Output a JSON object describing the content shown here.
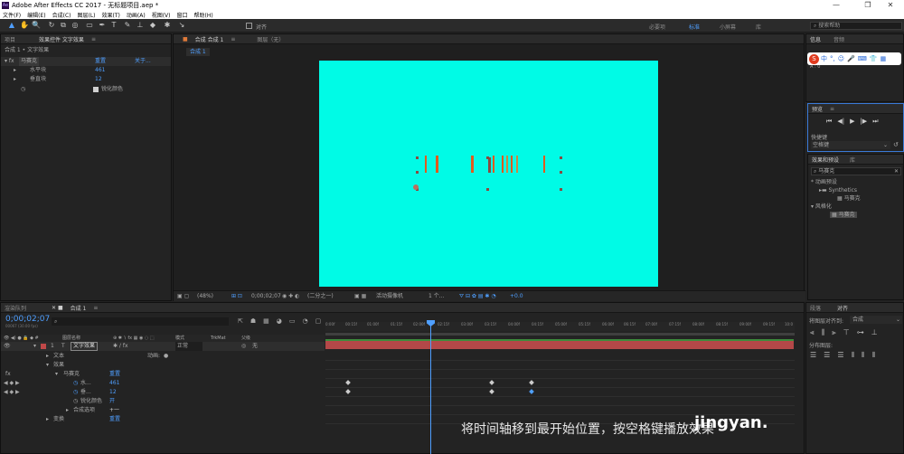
{
  "window": {
    "title": "Adobe After Effects CC 2017 - 无标题项目.aep *",
    "logo": "Ae",
    "controls": [
      "—",
      "❐",
      "✕"
    ]
  },
  "menu": [
    "文件(F)",
    "编辑(E)",
    "合成(C)",
    "图层(L)",
    "效果(T)",
    "动画(A)",
    "视图(V)",
    "窗口",
    "帮助(H)"
  ],
  "toolbar": {
    "tools": [
      "▲",
      "✋",
      "🔍",
      "↻",
      "⧉",
      "◎",
      "▭",
      "✒",
      "T",
      "✎",
      "⊥",
      "◆",
      "✱",
      "↘"
    ],
    "snap_label": "对齐",
    "workspaces": [
      "必要项",
      "标准",
      "小屏幕",
      "库"
    ],
    "active_workspace": "标准",
    "search_placeholder": "搜索帮助"
  },
  "project_panel": {
    "tabs": [
      "项目",
      "效果控件 文字效果",
      "≡"
    ],
    "breadcrumb": "合成 1 • 文字效果",
    "fx_row": {
      "label": "马赛克",
      "reset": "重置",
      "about": "关于..."
    },
    "params": [
      {
        "name": "水平块",
        "value": "461"
      },
      {
        "name": "垂直块",
        "value": "12"
      }
    ],
    "checkbox_label": "锐化颜色"
  },
  "composition_panel": {
    "tab": "合成 合成 1",
    "tab_menu": "≡",
    "layer_tab": "图层（无）",
    "sub_tab": "合成 1",
    "footer": {
      "zoom": "(48%)",
      "timecode": "0;00;02;07",
      "resolution": "(二分之一)",
      "camera": "活动摄像机",
      "views": "1 个...",
      "exposure": "+0.0"
    }
  },
  "info_panel": {
    "tabs": [
      "信息",
      "音频"
    ],
    "r_label": "R :",
    "a_label": "A : 0"
  },
  "ime_bar": {
    "items": [
      "中",
      "°,",
      "☺",
      "🎤",
      "⌨",
      "👕",
      "▦"
    ]
  },
  "preview_panel": {
    "title": "预览",
    "menu": "≡",
    "buttons": [
      "⏮",
      "◀|",
      "▶",
      "|▶",
      "⏭"
    ],
    "shortcut_label": "快捷键",
    "shortcut_value": "空格键"
  },
  "effects_panel": {
    "tabs": [
      "效果和预设",
      "库"
    ],
    "search_value": "马赛克",
    "tree": [
      {
        "label": "* 动画预设",
        "level": 0
      },
      {
        "label": "Synthetics",
        "level": 1
      },
      {
        "label": "马赛克",
        "level": 2
      },
      {
        "label": "风格化",
        "level": 0
      },
      {
        "label": "马赛克",
        "level": 2,
        "selected": true
      }
    ]
  },
  "align_panel": {
    "tabs": [
      "段落",
      "对齐"
    ],
    "align_to_label": "将图层对齐到:",
    "align_to_value": "合成",
    "distribute_label": "分布图层:"
  },
  "timeline": {
    "tabs": [
      "渲染队列",
      "合成 1"
    ],
    "tab_menu": "≡",
    "timecode": "0;00;02;07",
    "timecode_sub": "00067 (30.00 fps)",
    "header": {
      "layer_name": "图层名称",
      "mode": "模式",
      "trkmat": "TrkMat",
      "parent": "父级"
    },
    "ruler": [
      "0:00f",
      "00:15f",
      "01:00f",
      "01:15f",
      "02:00f",
      "02:15f",
      "03:00f",
      "03:15f",
      "04:00f",
      "04:15f",
      "05:00f",
      "05:15f",
      "06:00f",
      "06:15f",
      "07:00f",
      "07:15f",
      "08:00f",
      "08:15f",
      "09:00f",
      "09:15f",
      "10:0"
    ],
    "layer": {
      "index": "1",
      "type": "T",
      "name": "文字效果",
      "mode": "正常",
      "parent": "无"
    },
    "rows": [
      {
        "label": "文本",
        "indent": 1,
        "extra": "动画:",
        "extra_icon": "●"
      },
      {
        "label": "效果",
        "indent": 1
      },
      {
        "label": "马赛克",
        "indent": 2,
        "value": "重置",
        "fx": true
      },
      {
        "label": "水...",
        "indent": 3,
        "value": "461",
        "kf": true
      },
      {
        "label": "垂...",
        "indent": 3,
        "value": "12",
        "kf": true
      },
      {
        "label": "锐化颜色",
        "indent": 3,
        "value": "开"
      },
      {
        "label": "合成选项",
        "indent": 2,
        "value": "+一"
      },
      {
        "label": "变换",
        "indent": 1,
        "value": "重置"
      }
    ]
  },
  "overlay": {
    "caption": "将时间轴移到最开始位置，按空格键播放效果",
    "watermark": "jingyan."
  }
}
